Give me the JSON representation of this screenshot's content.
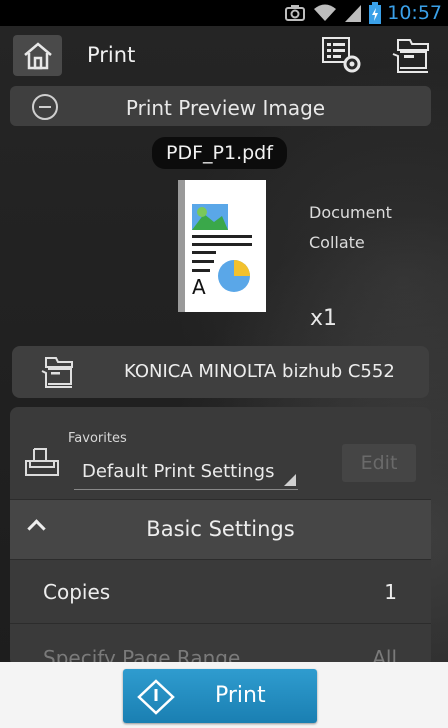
{
  "status_bar": {
    "time": "10:57",
    "time_color": "#3aa0e8"
  },
  "header": {
    "title": "Print"
  },
  "preview": {
    "label": "Print Preview Image",
    "file_name": "PDF_P1.pdf"
  },
  "document": {
    "info_line1": "Document",
    "info_line2": "Collate",
    "copies_multiplier": "x1"
  },
  "printer": {
    "name": "KONICA MINOLTA bizhub C552"
  },
  "favorites": {
    "label": "Favorites",
    "selected": "Default Print Settings",
    "edit_label": "Edit"
  },
  "basic_settings": {
    "label": "Basic Settings",
    "rows": [
      {
        "label": "Copies",
        "value": "1"
      },
      {
        "label": "Specify Page Range",
        "value": "All"
      }
    ]
  },
  "print_button": {
    "label": "Print",
    "color": "#1f8cc1"
  }
}
